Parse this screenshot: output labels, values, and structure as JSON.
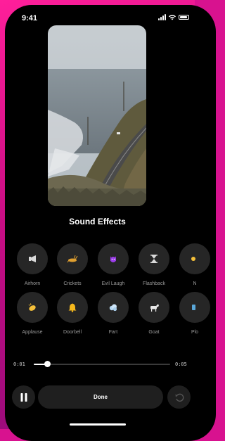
{
  "status_bar": {
    "time": "9:41"
  },
  "title": "Sound Effects",
  "effects_row1": [
    {
      "label": "Airhorn",
      "icon": "airhorn-icon"
    },
    {
      "label": "Crickets",
      "icon": "crickets-icon"
    },
    {
      "label": "Evil Laugh",
      "icon": "evil-laugh-icon"
    },
    {
      "label": "Flashback",
      "icon": "hourglass-icon"
    },
    {
      "label": "N",
      "icon": "partial-icon"
    }
  ],
  "effects_row2": [
    {
      "label": "Applause",
      "icon": "applause-icon"
    },
    {
      "label": "Doorbell",
      "icon": "bell-icon"
    },
    {
      "label": "Fart",
      "icon": "fart-icon"
    },
    {
      "label": "Goat",
      "icon": "goat-icon"
    },
    {
      "label": "Plo",
      "icon": "partial-icon"
    }
  ],
  "playback": {
    "current_time": "0:01",
    "end_time": "0:05",
    "progress": 0.1
  },
  "controls": {
    "done_label": "Done"
  },
  "colors": {
    "background": "#d8128f",
    "surface": "#262626",
    "evil_laugh_accent": "#9b3de8",
    "bell_accent": "#f5b81c"
  }
}
